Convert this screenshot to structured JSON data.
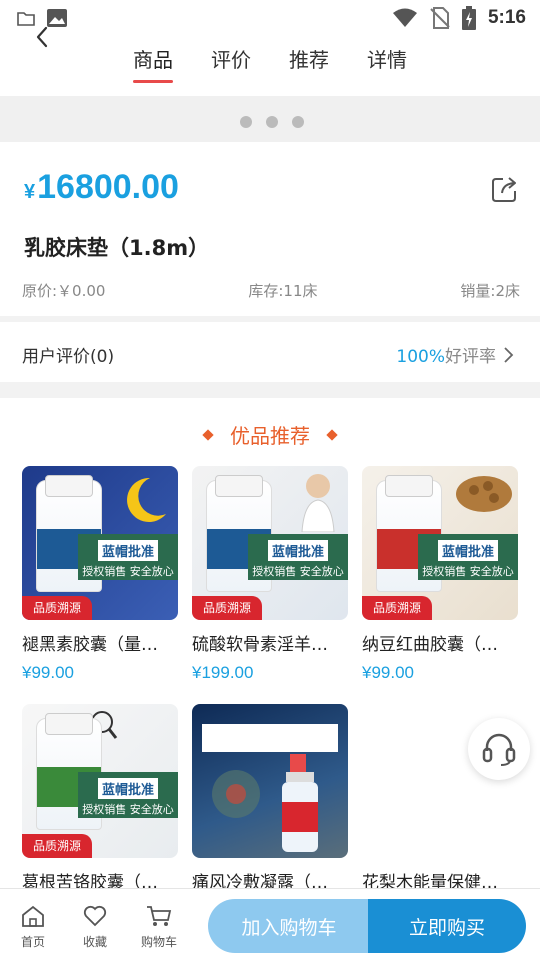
{
  "status_bar": {
    "time": "5:16",
    "icons": [
      "folder-icon",
      "image-icon",
      "wifi-icon",
      "no-sim-icon",
      "battery-icon"
    ]
  },
  "header": {
    "tabs": [
      {
        "label": "商品",
        "active": true
      },
      {
        "label": "评价",
        "active": false
      },
      {
        "label": "推荐",
        "active": false
      },
      {
        "label": "详情",
        "active": false
      }
    ]
  },
  "carousel": {
    "dots": 3
  },
  "product": {
    "currency": "¥",
    "price": "16800.00",
    "title": "乳胶床垫（1.8m）",
    "original_price": "原价:￥0.00",
    "stock": "库存:11床",
    "sales": "销量:2床"
  },
  "review": {
    "label": "用户评价(0)",
    "rate_value": "100%",
    "rate_label": "好评率"
  },
  "recommend": {
    "title": "优品推荐",
    "badge_text": "品质溯源",
    "banner_title": "蓝帽批准",
    "banner_sub": "授权销售 安全放心",
    "items": [
      {
        "name": "褪黑素胶囊（量…",
        "price": "¥99.00",
        "color": "#1d5a95"
      },
      {
        "name": "硫酸软骨素淫羊…",
        "price": "¥199.00",
        "color": "#1d5a95"
      },
      {
        "name": "纳豆红曲胶囊（…",
        "price": "¥99.00",
        "color": "#c9302c"
      },
      {
        "name": "葛根苦铬胶囊（…",
        "price": "",
        "color": "#3a8a3a"
      },
      {
        "name": "痛风冷敷凝露（…",
        "price": "",
        "color": "#1c3a6b"
      },
      {
        "name": "花梨木能量保健…",
        "price": ""
      }
    ]
  },
  "bottom_bar": {
    "home": "首页",
    "favorite": "收藏",
    "cart": "购物车",
    "add_to_cart": "加入购物车",
    "buy_now": "立即购买"
  },
  "colors": {
    "accent": "#1aa0e0",
    "primary_button": "#1a8fd4",
    "secondary_button": "#8ec9ef",
    "recommend_title": "#e8602c",
    "tab_indicator": "#e84a4a"
  }
}
